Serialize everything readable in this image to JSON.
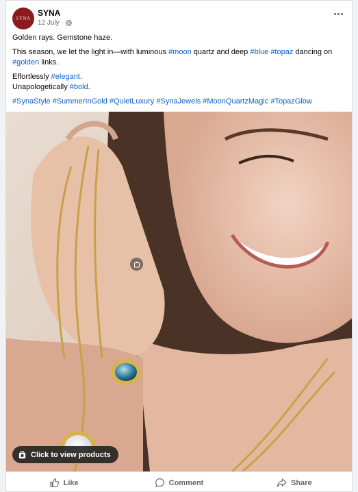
{
  "post": {
    "author": {
      "avatar_text": "SYNA",
      "name": "SYNA"
    },
    "date": "12 July",
    "date_sep": "·",
    "caption": {
      "line1": "Golden rays. Gemstone haze.",
      "line2": [
        {
          "t": "This season, we let the light in—with luminous ",
          "tag": false
        },
        {
          "t": "#moon",
          "tag": true
        },
        {
          "t": " quartz and deep ",
          "tag": false
        },
        {
          "t": "#blue",
          "tag": true
        },
        {
          "t": " ",
          "tag": false
        },
        {
          "t": "#topaz",
          "tag": true
        },
        {
          "t": " dancing on ",
          "tag": false
        },
        {
          "t": "#golden",
          "tag": true
        },
        {
          "t": " links.",
          "tag": false
        }
      ],
      "line3": [
        {
          "t": "Effortlessly ",
          "tag": false
        },
        {
          "t": "#elegant",
          "tag": true
        },
        {
          "t": ".",
          "tag": false
        }
      ],
      "line4": [
        {
          "t": "Unapologetically ",
          "tag": false
        },
        {
          "t": "#bold",
          "tag": true
        },
        {
          "t": ".",
          "tag": false
        }
      ],
      "hashtags": [
        "#SynaStyle",
        "#SummerInGold",
        "#QuietLuxury",
        "#SynaJewels",
        "#MoonQuartzMagic",
        "#TopazGlow"
      ]
    },
    "view_products_label": "Click to view products",
    "actions": {
      "like": "Like",
      "comment": "Comment",
      "share": "Share"
    }
  },
  "colors": {
    "hashtag": "#0a5fc7",
    "avatar_bg": "#8b1a1f",
    "meta": "#65676b"
  },
  "icons": [
    "globe-icon",
    "more-options-icon",
    "shopping-bag-icon",
    "product-tag-icon",
    "like-icon",
    "comment-icon",
    "share-icon"
  ]
}
